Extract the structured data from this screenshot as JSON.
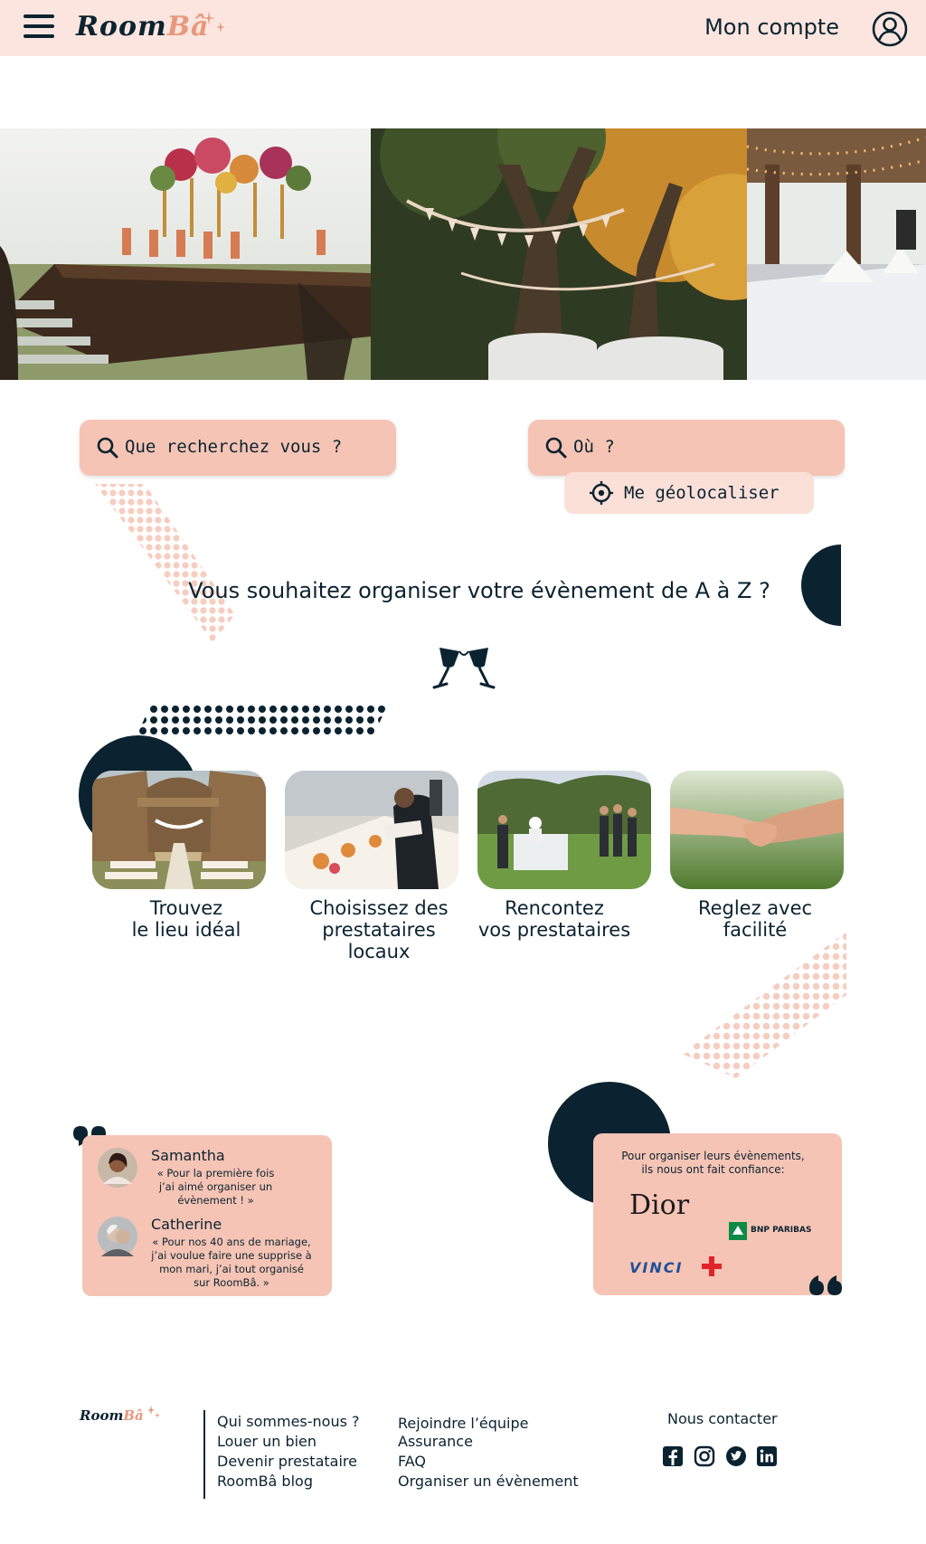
{
  "header": {
    "logo_main": "Room",
    "logo_accent": "Bâ",
    "account_label": "Mon compte"
  },
  "search": {
    "what_placeholder": "Que recherchez vous ?",
    "where_placeholder": "Où ?",
    "geolocate_label": "Me géolocaliser"
  },
  "headline": "Vous souhaitez organiser votre évènement de A à Z ?",
  "steps": [
    {
      "label": "Trouvez\nle lieu idéal"
    },
    {
      "label": "Choisissez des\nprestataires\nlocaux"
    },
    {
      "label": "Rencontez\nvos prestataires"
    },
    {
      "label": "Reglez avec\nfacilité"
    }
  ],
  "testimonials": [
    {
      "name": "Samantha",
      "quote": "« Pour la première fois\nj’ai aimé organiser un\névènement ! »"
    },
    {
      "name": "Catherine",
      "quote": "« Pour nos 40 ans de mariage,\nj’ai voulue faire une supprise à\nmon mari, j’ai tout organisé\nsur RoomBâ. »"
    }
  ],
  "partners": {
    "intro": "Pour organiser leurs évènements,\nils nous ont fait confiance:",
    "logos": [
      "Dior",
      "BNP PARIBAS",
      "VINCI"
    ]
  },
  "footer": {
    "logo_main": "Room",
    "logo_accent": "Bâ",
    "col1": [
      "Qui sommes-nous ?",
      "Louer un bien",
      "Devenir prestataire",
      "RoomBâ blog"
    ],
    "col2": [
      "Rejoindre l’équipe",
      "Assurance",
      "FAQ",
      "Organiser un évènement"
    ],
    "contact_title": "Nous contacter",
    "social_icons": [
      "facebook-icon",
      "instagram-icon",
      "twitter-icon",
      "linkedin-icon"
    ]
  },
  "colors": {
    "navy": "#0b2330",
    "peach": "#f5c4b4",
    "peach_light": "#fbe5de",
    "accent": "#e8987c"
  }
}
